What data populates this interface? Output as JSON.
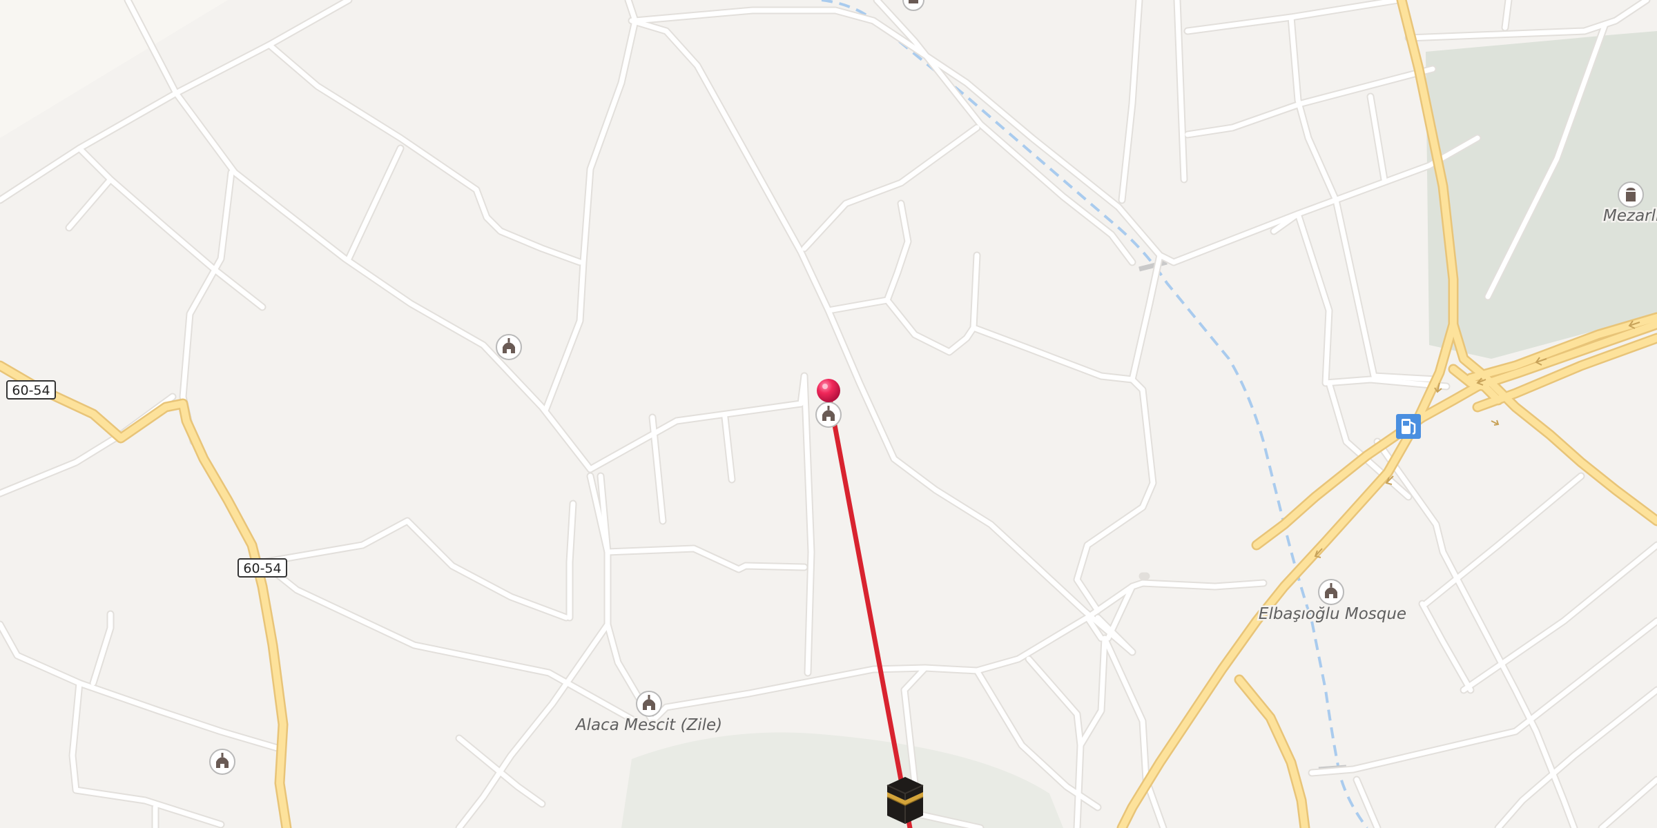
{
  "map": {
    "colors": {
      "background": "#f4f2ef",
      "road_minor": "#ffffff",
      "road_casing": "#e2dfdb",
      "road_major": "#fde29b",
      "road_major_casing": "#e8c478",
      "railway": "#a9cbee",
      "cemetery_area": "#dde2da",
      "park_area": "#e9ebe5",
      "qibla_line": "#d8232f",
      "location_pin": "#f0285a",
      "fuel_marker": "#4a8fe0"
    },
    "road_shields": [
      {
        "name": "road-shield-60-54-west",
        "label": "60-54"
      },
      {
        "name": "road-shield-60-54-center",
        "label": "60-54"
      }
    ],
    "place_labels": [
      {
        "name": "poi-label-alaca-mescit",
        "label": "Alaca Mescit (Zile)"
      },
      {
        "name": "poi-label-elbasioglu-mosque",
        "label": "Elbaşıoğlu Mosque"
      },
      {
        "name": "poi-label-mezarlik",
        "label": "Mezarlık"
      }
    ],
    "markers": {
      "user_location": "location-pin",
      "qibla_target": "kaaba-icon",
      "mosque_icon": "mosque-icon",
      "cemetery_icon": "cemetery-icon",
      "fuel_icon": "fuel-station-icon"
    }
  }
}
